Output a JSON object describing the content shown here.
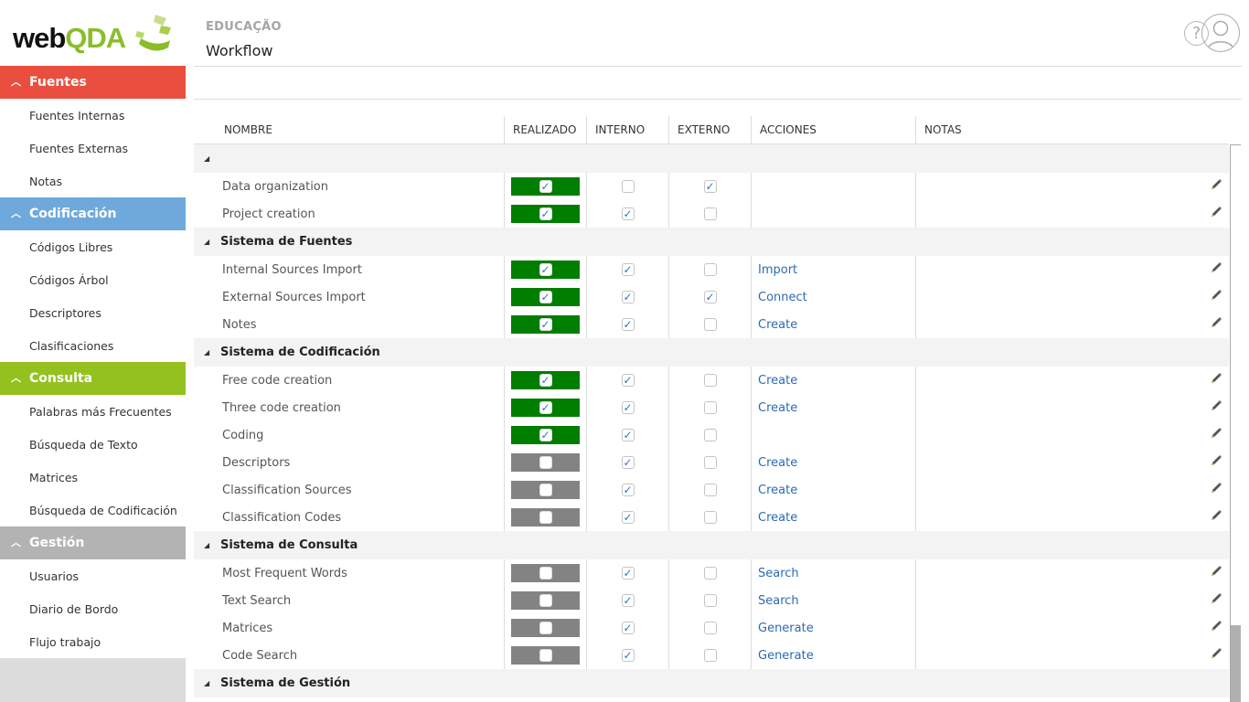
{
  "app": {
    "logo_primary": "web",
    "logo_accent": "QDA",
    "logo_mark": "®"
  },
  "header": {
    "breadcrumb": "EDUCAÇÃO",
    "title": "Workflow",
    "help_glyph": "?"
  },
  "sidebar": {
    "sections": [
      {
        "label": "Fuentes",
        "color": "#e94e3e",
        "expanded": true,
        "items": [
          "Fuentes Internas",
          "Fuentes Externas",
          "Notas"
        ]
      },
      {
        "label": "Codificación",
        "color": "#6fa9dc",
        "expanded": true,
        "items": [
          "Códigos Libres",
          "Códigos Árbol",
          "Descriptores",
          "Clasificaciones"
        ]
      },
      {
        "label": "Consulta",
        "color": "#95c11f",
        "expanded": true,
        "items": [
          "Palabras más Frecuentes",
          "Búsqueda de Texto",
          "Matrices",
          "Búsqueda de Codificación"
        ]
      },
      {
        "label": "Gestión",
        "color": "#b3b3b3",
        "expanded": true,
        "items": [
          "Usuarios",
          "Diario de Bordo",
          "Flujo trabajo"
        ]
      }
    ]
  },
  "table": {
    "columns": [
      "NOMBRE",
      "REALIZADO",
      "INTERNO",
      "EXTERNO",
      "ACCIONES",
      "NOTAS"
    ],
    "colors": {
      "done": "#007e00",
      "not_done": "#838383",
      "link": "#2a6ab5"
    },
    "groups": [
      {
        "title": "",
        "rows": [
          {
            "name": "Data organization",
            "done": true,
            "internal": false,
            "external": true,
            "action": ""
          },
          {
            "name": "Project creation",
            "done": true,
            "internal": true,
            "external": false,
            "action": ""
          }
        ]
      },
      {
        "title": "Sistema de Fuentes",
        "rows": [
          {
            "name": "Internal Sources Import",
            "done": true,
            "internal": true,
            "external": false,
            "action": "Import"
          },
          {
            "name": "External Sources Import",
            "done": true,
            "internal": true,
            "external": true,
            "action": "Connect"
          },
          {
            "name": "Notes",
            "done": true,
            "internal": true,
            "external": false,
            "action": "Create"
          }
        ]
      },
      {
        "title": "Sistema de Codificación",
        "rows": [
          {
            "name": "Free code creation",
            "done": true,
            "internal": true,
            "external": false,
            "action": "Create"
          },
          {
            "name": "Three code creation",
            "done": true,
            "internal": true,
            "external": false,
            "action": "Create"
          },
          {
            "name": "Coding",
            "done": true,
            "internal": true,
            "external": false,
            "action": ""
          },
          {
            "name": "Descriptors",
            "done": false,
            "internal": true,
            "external": false,
            "action": "Create"
          },
          {
            "name": "Classification Sources",
            "done": false,
            "internal": true,
            "external": false,
            "action": "Create"
          },
          {
            "name": "Classification Codes",
            "done": false,
            "internal": true,
            "external": false,
            "action": "Create"
          }
        ]
      },
      {
        "title": "Sistema de Consulta",
        "rows": [
          {
            "name": "Most Frequent Words",
            "done": false,
            "internal": true,
            "external": false,
            "action": "Search"
          },
          {
            "name": "Text Search",
            "done": false,
            "internal": true,
            "external": false,
            "action": "Search"
          },
          {
            "name": "Matrices",
            "done": false,
            "internal": true,
            "external": false,
            "action": "Generate"
          },
          {
            "name": "Code Search",
            "done": false,
            "internal": true,
            "external": false,
            "action": "Generate"
          }
        ]
      },
      {
        "title": "Sistema de Gestión",
        "rows": []
      }
    ]
  },
  "icons": {
    "expand": "▲",
    "collapse_section": "^",
    "check": "✓",
    "edit": "pencil-icon"
  }
}
